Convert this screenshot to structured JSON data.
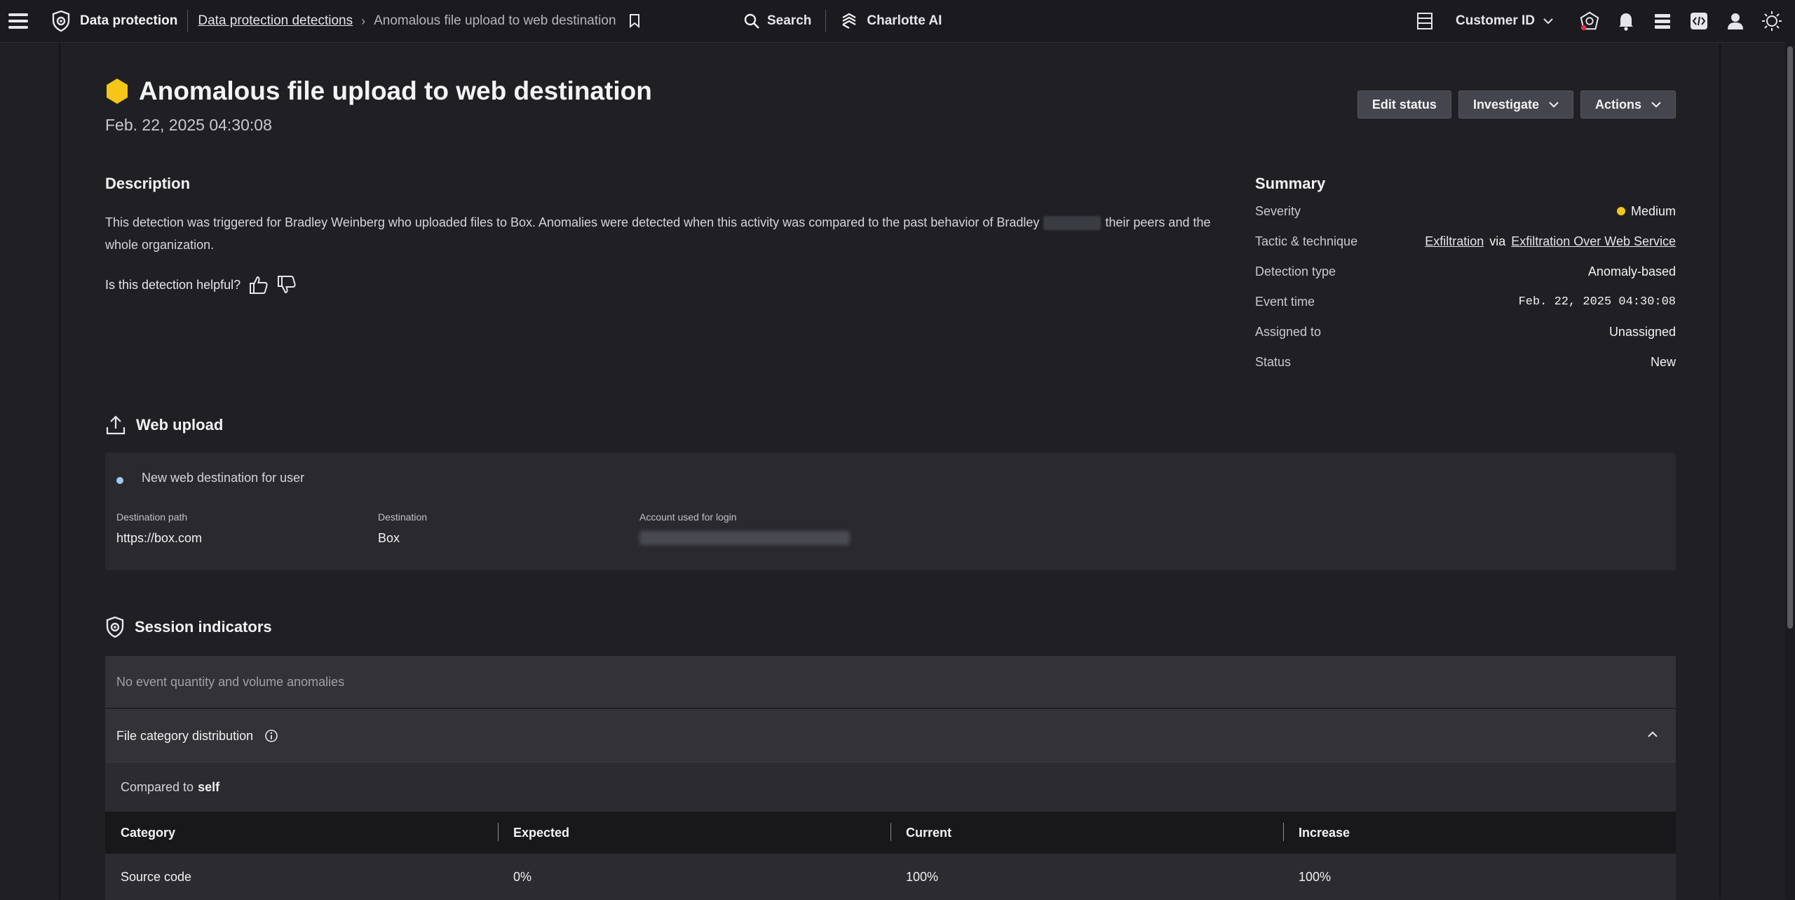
{
  "topbar": {
    "app_name": "Data protection",
    "breadcrumb_link": "Data protection detections",
    "breadcrumb_current": "Anomalous file upload to web destination",
    "search_label": "Search",
    "charlotte_label": "Charlotte AI",
    "customer_label": "Customer ID",
    "icons": [
      "menu-icon",
      "shield-logo-icon",
      "bookmark-icon",
      "search-icon",
      "charlotte-ai-icon",
      "table-icon",
      "chevron-down-icon",
      "incident-icon",
      "bell-icon",
      "stack-icon",
      "code-icon",
      "user-icon",
      "sun-icon"
    ]
  },
  "header": {
    "title": "Anomalous file upload to web destination",
    "date": "Feb. 22, 2025 04:30:08",
    "severity_color": "#f5c518",
    "buttons": {
      "edit_status": "Edit status",
      "investigate": "Investigate",
      "actions": "Actions"
    }
  },
  "description": {
    "heading": "Description",
    "text_part1": "This detection was triggered for Bradley Weinberg who uploaded files to Box. Anomalies were detected when this activity was compared to the past behavior of Bradley",
    "text_part2": "their peers and the whole organization.",
    "helpful_prompt": "Is this detection helpful?"
  },
  "summary": {
    "heading": "Summary",
    "rows": [
      {
        "label": "Severity",
        "value": "Medium"
      },
      {
        "label": "Tactic & technique",
        "tactic": "Exfiltration",
        "via": "via",
        "technique": "Exfiltration Over Web Service"
      },
      {
        "label": "Detection type",
        "value": "Anomaly-based"
      },
      {
        "label": "Event time",
        "value": "Feb. 22, 2025 04:30:08"
      },
      {
        "label": "Assigned to",
        "value": "Unassigned"
      },
      {
        "label": "Status",
        "value": "New"
      }
    ]
  },
  "web_upload": {
    "heading": "Web upload",
    "note": "New web destination for user",
    "fields": [
      {
        "label": "Destination path",
        "value": "https://box.com"
      },
      {
        "label": "Destination",
        "value": "Box"
      },
      {
        "label": "Account used for login",
        "value": ""
      }
    ]
  },
  "session_indicators": {
    "heading": "Session indicators",
    "empty_message": "No event quantity and volume anomalies",
    "accordion_title": "File category distribution",
    "compared_label": "Compared to",
    "compared_value": "self",
    "columns": [
      "Category",
      "Expected",
      "Current",
      "Increase"
    ],
    "rows": [
      [
        "Source code",
        "0%",
        "100%",
        "100%"
      ]
    ]
  }
}
